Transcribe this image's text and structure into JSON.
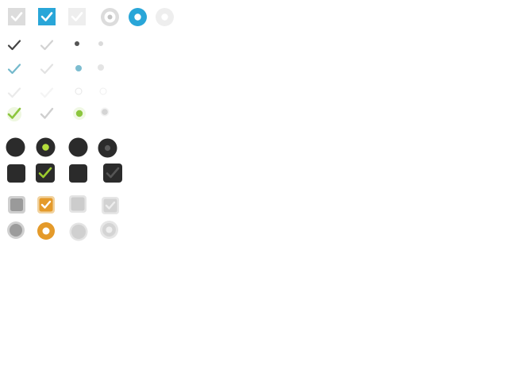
{
  "title": "",
  "sets": [
    {
      "name": "flat-blue",
      "accent": "#29a6d8",
      "controls": [
        "checkbox-unchecked",
        "checkbox-checked",
        "checkbox-disabled",
        "radio-unchecked",
        "radio-checked",
        "radio-disabled"
      ]
    },
    {
      "name": "minimal-dark",
      "accent": "#444444",
      "controls": [
        "checkmark",
        "checkmark-light",
        "dot",
        "dot-light"
      ]
    },
    {
      "name": "minimal-aero",
      "accent": "#74b9cc",
      "controls": [
        "checkmark",
        "checkmark-light",
        "dot",
        "dot-light"
      ]
    },
    {
      "name": "minimal-white",
      "accent": "#f2f2f2",
      "controls": [
        "checkmark",
        "checkmark-light",
        "dot",
        "dot-light"
      ]
    },
    {
      "name": "minimal-green",
      "accent": "#8cc63e",
      "controls": [
        "checkmark",
        "checkmark-light",
        "dot",
        "dot-light"
      ]
    },
    {
      "name": "dark-round",
      "accent": "#b5de3c",
      "controls": [
        "radio-unchecked",
        "radio-checked",
        "radio-disabled",
        "radio-disabled-checked"
      ]
    },
    {
      "name": "dark-square",
      "accent": "#9ccc2e",
      "controls": [
        "checkbox-unchecked",
        "checkbox-checked",
        "checkbox-disabled",
        "checkbox-disabled-checked"
      ]
    },
    {
      "name": "orange-square",
      "accent": "#e49a2a",
      "controls": [
        "checkbox-unchecked",
        "checkbox-checked",
        "checkbox-disabled",
        "checkbox-disabled-checked"
      ]
    },
    {
      "name": "orange-round",
      "accent": "#e49a2a",
      "controls": [
        "radio-unchecked",
        "radio-checked",
        "radio-disabled",
        "radio-disabled-checked"
      ]
    }
  ]
}
